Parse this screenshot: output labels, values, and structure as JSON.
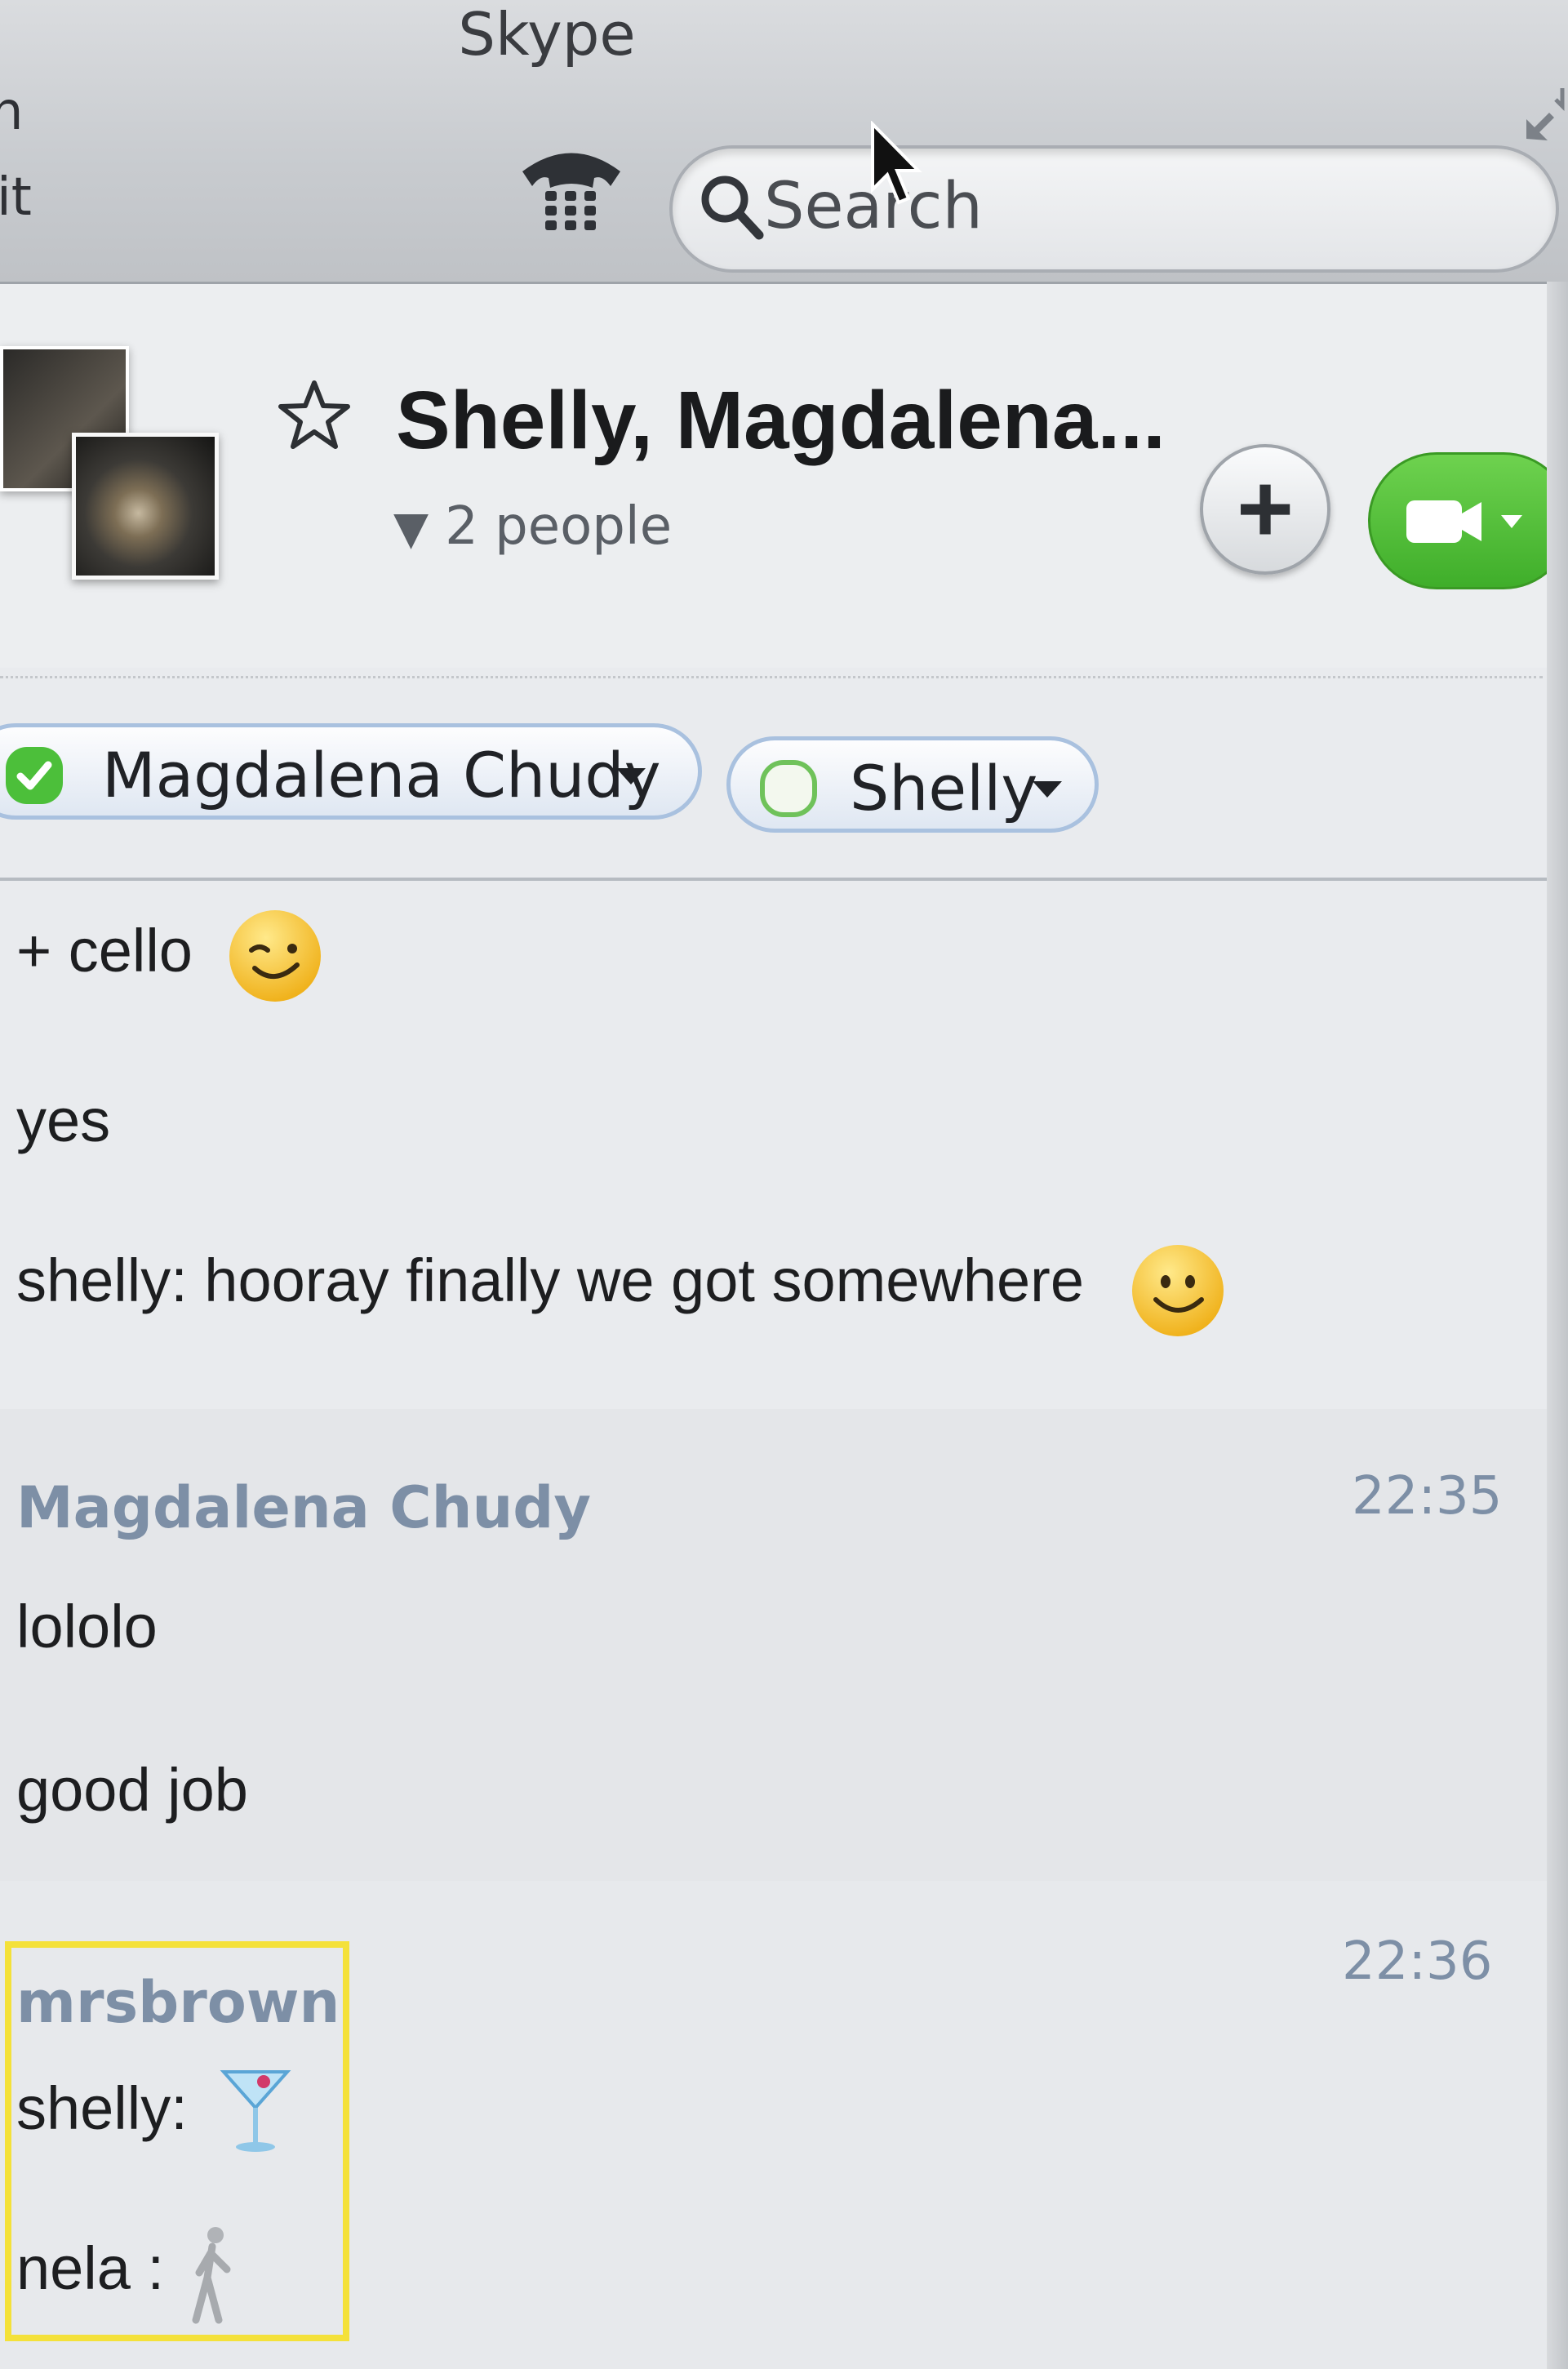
{
  "window": {
    "title": "Skype",
    "left_clipped_menu": [
      "n",
      "it"
    ]
  },
  "toolbar": {
    "dialpad_icon": "dialpad-phone-icon",
    "search": {
      "placeholder": "Search",
      "value": ""
    }
  },
  "conversation": {
    "title": "Shelly, Magdalena...",
    "people_toggle": "2 people",
    "add_button_label": "+",
    "video_button_icon": "video-camera-icon"
  },
  "participants": [
    {
      "name": "Magdalena Chudy",
      "status": "online"
    },
    {
      "name": "Shelly",
      "status": "offline"
    }
  ],
  "messages": {
    "intro": [
      {
        "text": "+ cello",
        "emoji": "wink-emoji"
      },
      {
        "text": "yes"
      },
      {
        "text": "shelly: hooray finally we got somewhere",
        "emoji": "smile-emoji"
      }
    ],
    "groups": [
      {
        "sender": "Magdalena Chudy",
        "time": "22:35",
        "lines": [
          "lololo",
          "good job"
        ]
      },
      {
        "sender": "mrsbrown",
        "time": "22:36",
        "lines": [
          {
            "text": "shelly:",
            "emoji": "cocktail-emoji"
          },
          {
            "text": "nela :",
            "emoji": "walking-person-emoji"
          }
        ]
      }
    ]
  },
  "colors": {
    "sender_name": "#7d8fa6",
    "video_green": "#3fae2a",
    "chip_border": "#a9c1df",
    "highlight": "#f4e13a"
  }
}
